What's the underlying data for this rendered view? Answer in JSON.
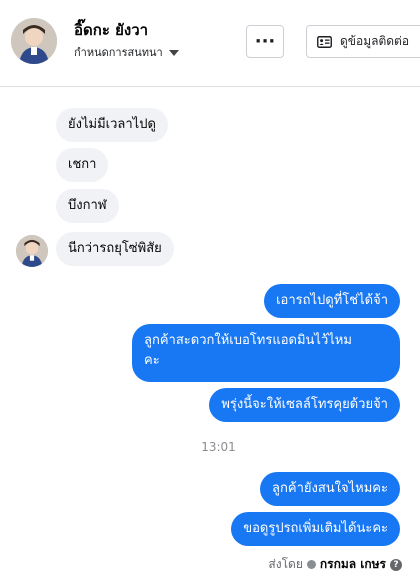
{
  "header": {
    "name": "อิ๊ดกะ ยังวา",
    "subtitle": "กำหนดการสนทนา",
    "more_label": "···",
    "contact_label": "ดูข้อมูลติดต่อ"
  },
  "messages": {
    "incoming": [
      "ยังไม่มีเวลาไปดู",
      "เชกา",
      "บึงกาฬ",
      "นีกว่ารถยุโซ่พิสัย"
    ],
    "outgoing": [
      "เอารถไปดูที่โช่ได้จ้า",
      "ลูกค้าสะดวกให้เบอโทรแอดมินไว้ไหม",
      "คะ",
      "พรุ่งนี้จะให้เซลล์โทรคุยด้วยจ้า",
      "ลูกค้ายังสนใจไหมคะ",
      "ขอดูรูปรถเพิ่มเติมได้นะคะ"
    ]
  },
  "timestamp": "13:01",
  "sent_by": {
    "prefix": "ส่งโดย",
    "name": "กรกมล เกษร",
    "help": "?"
  },
  "colors": {
    "accent": "#1877f2",
    "incoming_bubble": "#f0f2f5"
  }
}
